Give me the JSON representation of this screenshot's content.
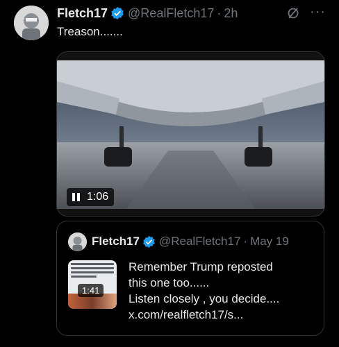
{
  "post": {
    "author_name": "Fletch17",
    "handle": "@RealFletch17",
    "separator": "·",
    "time": "2h",
    "more_label": "···",
    "text": "Treason.......",
    "video": {
      "duration": "1:06",
      "state": "playing"
    }
  },
  "quote": {
    "author_name": "Fletch17",
    "handle": "@RealFletch17",
    "separator": "·",
    "date": "May 19",
    "thumb_duration": "1:41",
    "lines": [
      "Remember Trump reposted",
      "this one too......",
      "Listen closely , you decide....",
      "x.com/realfletch17/s..."
    ]
  },
  "colors": {
    "background": "#000000",
    "primary_text": "#e7e9ea",
    "secondary_text": "#71767b",
    "verified": "#1d9bf0",
    "border": "#2f3336"
  },
  "icons": [
    "verified-badge-icon",
    "grok-icon",
    "more-icon",
    "pause-icon"
  ]
}
